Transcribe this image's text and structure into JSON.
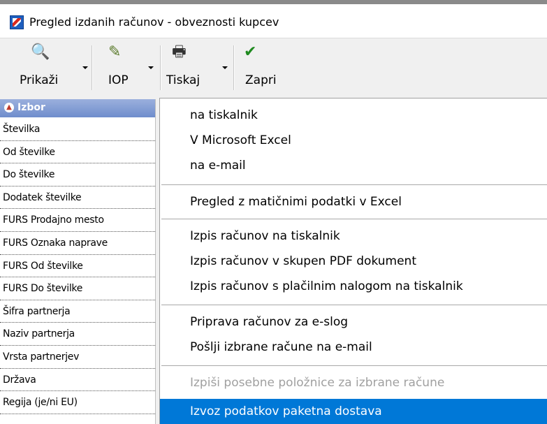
{
  "window": {
    "title": "Pregled izdanih računov - obveznosti kupcev"
  },
  "toolbar": {
    "buttons": [
      {
        "label": "Prikaži",
        "icon": "magnifier-icon"
      },
      {
        "label": "IOP",
        "icon": "iop-icon"
      },
      {
        "label": "Tiskaj",
        "icon": "printer-icon"
      },
      {
        "label": "Zapri",
        "icon": "checkmark-icon"
      }
    ]
  },
  "left_panel": {
    "header": "Izbor",
    "fields": [
      "Številka",
      "Od številke",
      "Do številke",
      "Dodatek številke",
      "FURS Prodajno mesto",
      "FURS Oznaka naprave",
      "FURS Od številke",
      "FURS Do številke",
      "Šifra partnerja",
      "Naziv partnerja",
      "Vrsta partnerjev",
      "Država",
      "Regija (je/ni EU)"
    ]
  },
  "menu": {
    "items": [
      "na tiskalnik",
      "V Microsoft Excel",
      "na e-mail",
      "Pregled z matičnimi podatki v Excel",
      "Izpis računov na tiskalnik",
      "Izpis računov v skupen PDF dokument",
      "Izpis računov s plačilnim nalogom na tiskalnik",
      "Priprava računov za e-slog",
      "Pošlji izbrane račune na e-mail",
      "Izpiši posebne položnice za izbrane račune",
      "Izvoz podatkov paketna dostava"
    ],
    "disabled_item": "Izpiši posebne položnice za izbrane račune",
    "selected_item": "Izvoz podatkov paketna dostava"
  },
  "colors": {
    "selection": "#0078d7",
    "panel_header": "#6f8dcc",
    "disabled_text": "#a0a0a0"
  }
}
